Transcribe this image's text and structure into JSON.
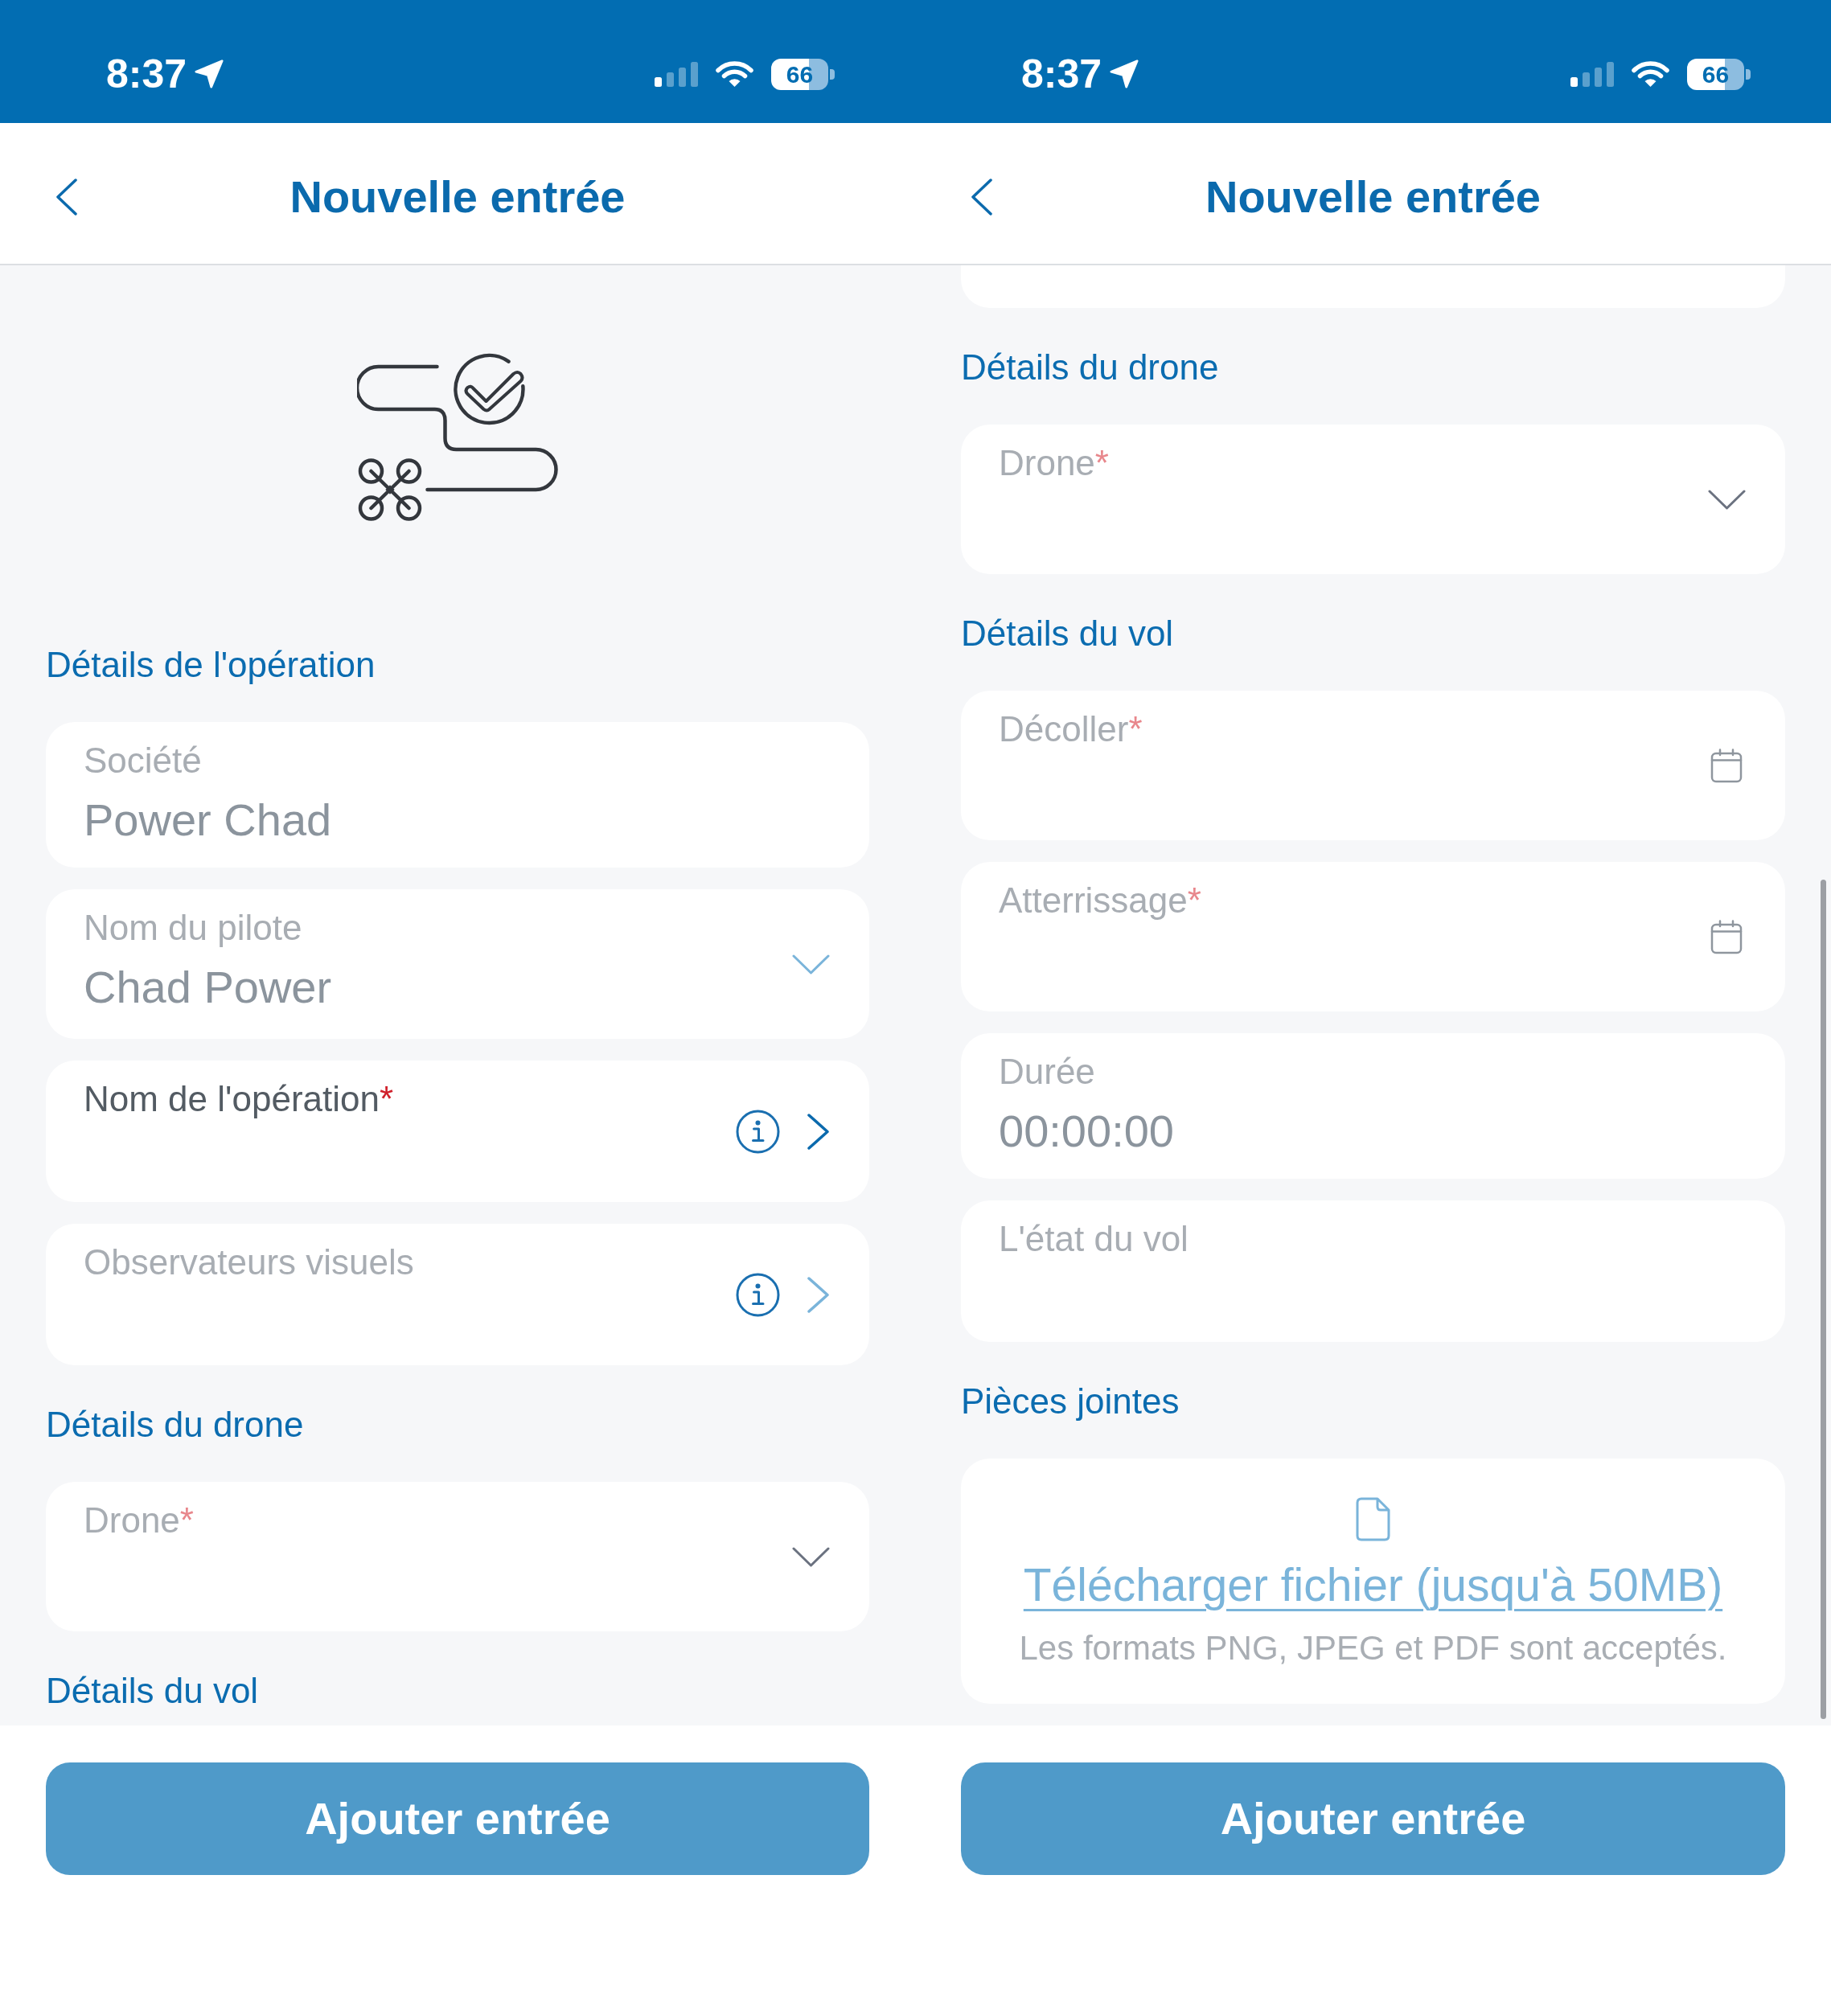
{
  "screens": [
    {
      "status_bar": {
        "time": "8:37",
        "battery": "66"
      },
      "header": {
        "title": "Nouvelle entrée"
      },
      "content": [
        {
          "kind": "illustration"
        },
        {
          "kind": "section",
          "title": "Détails de l'opération"
        },
        {
          "kind": "text_field",
          "label": "Société",
          "value": "Power Chad",
          "active": false,
          "info": false
        },
        {
          "kind": "dropdown_field",
          "label": "Nom du pilote",
          "value": "Chad Power",
          "active": false,
          "info": false
        },
        {
          "kind": "link_field",
          "label": "Nom de l'opération",
          "required_mark": "*",
          "active": true,
          "info": true
        },
        {
          "kind": "link_field",
          "label": "Observateurs visuels",
          "active": false,
          "info": true
        },
        {
          "kind": "section",
          "title": "Détails du drone"
        },
        {
          "kind": "dropdown_field",
          "label": "Drone",
          "required_mark": "*",
          "active": false,
          "info": false
        },
        {
          "kind": "section",
          "title": "Détails du vol"
        }
      ],
      "footer": {
        "button": "Ajouter entrée"
      }
    },
    {
      "status_bar": {
        "time": "8:37",
        "battery": "66"
      },
      "header": {
        "title": "Nouvelle entrée"
      },
      "scrollbar": true,
      "content": [
        {
          "kind": "clipped_card"
        },
        {
          "kind": "section",
          "title": "Détails du drone"
        },
        {
          "kind": "dropdown_field",
          "label": "Drone",
          "required_mark": "*",
          "active": false,
          "info": false
        },
        {
          "kind": "section",
          "title": "Détails du vol"
        },
        {
          "kind": "date_field",
          "label": "Décoller",
          "required_mark": "*",
          "active": false,
          "info": false
        },
        {
          "kind": "date_field",
          "label": "Atterrissage",
          "required_mark": "*",
          "active": false,
          "info": false
        },
        {
          "kind": "text_field",
          "label": "Durée",
          "value": "00:00:00",
          "active": false,
          "info": false
        },
        {
          "kind": "text_field",
          "label": "L'état du vol",
          "active": false,
          "info": false
        },
        {
          "kind": "section",
          "title": "Pièces jointes"
        },
        {
          "kind": "upload",
          "link": "Télécharger fichier (jusqu'à 50MB)",
          "hint": "Les formats PNG, JPEG et PDF sont acceptés."
        }
      ],
      "footer": {
        "button": "Ajouter entrée"
      }
    }
  ]
}
